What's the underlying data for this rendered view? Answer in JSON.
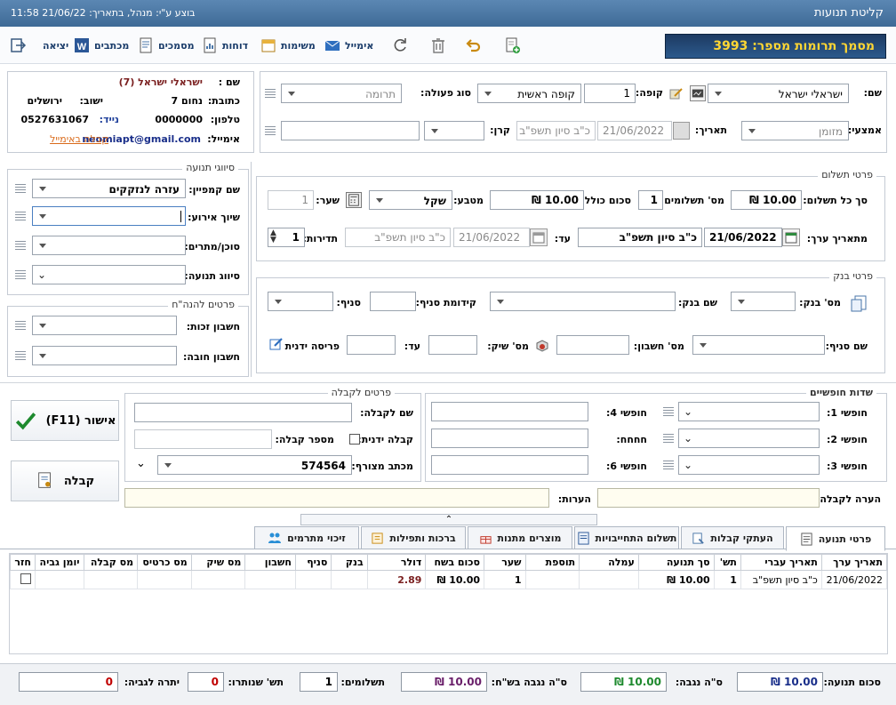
{
  "window": {
    "title": "קליטת תנועות",
    "status": "בוצע ע\"י: מנהל, בתאריך: 21/06/22 11:58"
  },
  "banner": "מסמך תרומות מספר: 3993",
  "toolbar": {
    "exit": "יציאה",
    "letters": "מכתבים",
    "documents": "מסמכים",
    "reports": "דוחות",
    "tasks": "משימות",
    "email": "אימייל"
  },
  "donor": {
    "name_label": "שם :",
    "name": "ישראלי ישראל (7)",
    "address_label": "כתובת:",
    "address": "נחום 7",
    "city_label": "ישוב:",
    "city": "ירושלים",
    "phone_label": "טלפון:",
    "phone": "0000000",
    "mobile_label": "נייד:",
    "mobile": "0527631067",
    "email_label": "אימייל:",
    "email": "neomiapt@gmail.com",
    "email_receipt": "קבלה באימייל"
  },
  "header": {
    "name_label": "שם:",
    "name": "ישראלי ישראל",
    "cashbox_label": "קופה:",
    "cashbox_num": "1",
    "cashbox": "קופה ראשית",
    "action_label": "סוג פעולה:",
    "action": "תרומה",
    "means_label": "אמצעי:",
    "means": "מזומן",
    "date_label": "תאריך:",
    "date": "21/06/2022",
    "hebdate": "כ\"ב סיון תשפ\"ב",
    "fund_label": "קרן:"
  },
  "payment": {
    "section": "פרטי תשלום",
    "each_label": "סך כל תשלום:",
    "each": "10.00 ₪",
    "count_label": "מס' תשלומים",
    "count": "1",
    "total_label": "סכום כולל:",
    "total": "10.00 ₪",
    "currency_label": "מטבע:",
    "currency": "שקל",
    "rate_label": "שער:",
    "rate": "1",
    "from_label": "מתאריך ערך:",
    "from_date": "21/06/2022",
    "from_heb": "כ\"ב סיון תשפ\"ב",
    "to_label": "עד:",
    "to_date": "21/06/2022",
    "to_heb": "כ\"ב סיון תשפ\"ב",
    "freq_label": "תדירות:",
    "freq": "1"
  },
  "bank": {
    "section": "פרטי בנק",
    "bank_num_label": "מס' בנק:",
    "bank_name_label": "שם בנק:",
    "prefix_label": "קידומת סניף:",
    "branch_label": "סניף:",
    "branch_name_label": "שם סניף:",
    "account_label": "מס' חשבון:",
    "check_label": "מס' שיק:",
    "until_label": "עד:",
    "manual_label": "פריסה ידנית"
  },
  "classes": {
    "section": "סיווגי תנועה",
    "campaign_label": "שם קמפיין:",
    "campaign": "עזרה לנזקקים",
    "event_label": "שיוך אירוע:",
    "agent_label": "סוכן/מתרים:",
    "class_label": "סיווג תנועה:"
  },
  "accounting": {
    "section": "פרטים להנה\"ח",
    "credit_label": "חשבון זכות:",
    "debit_label": "חשבון חובה:"
  },
  "free": {
    "section": "שדות חופשיים",
    "f1": "חופשי 1:",
    "f2": "חופשי 2:",
    "f3": "חופשי 3:",
    "f4": "חופשי 4:",
    "f5": "חחחח:",
    "f6": "חופשי 6:"
  },
  "receipt": {
    "section": "פרטים לקבלה",
    "name_label": "שם לקבלה:",
    "manual_label": "קבלה ידנית:",
    "number_label": "מספר קבלה:",
    "letter_label": "מכתב מצורף:",
    "letter": "574564",
    "notes_label": "הערות:",
    "receipt_note_label": "הערה לקבלה:"
  },
  "buttons": {
    "confirm": "אישור (F11)",
    "receipt": "קבלה"
  },
  "tabs": [
    "פרטי תנועה",
    "העתקי קבלות",
    "תשלום התחייבויות",
    "מוצרים מתנות",
    "ברכות ותפילות",
    "זיכוי מתרמים"
  ],
  "grid": {
    "columns": [
      "תאריך ערך",
      "תאריך עברי",
      "תש'",
      "סך תנועה",
      "עמלה",
      "תוספת",
      "שער",
      "סכום בשח",
      "דולר",
      "בנק",
      "סניף",
      "חשבון",
      "מס שיק",
      "מס כרטיס",
      "מס קבלה",
      "יומן גביה",
      "חזר"
    ],
    "rows": [
      [
        "21/06/2022",
        "כ\"ב סיון תשפ\"ב",
        "1",
        "10.00 ₪",
        "",
        "",
        "1",
        "10.00 ₪",
        "2.89",
        "",
        "",
        "",
        "",
        "",
        "",
        "",
        ""
      ]
    ]
  },
  "footer": {
    "total_label": "סכום תנועה:",
    "total": "10.00 ₪",
    "collected_label": "ס\"ה נגבה:",
    "collected": "10.00 ₪",
    "collected_nis_label": "ס\"ה נגבה בש\"ח:",
    "collected_nis": "10.00 ₪",
    "payments_label": "תשלומים:",
    "payments": "1",
    "paid_label": "תש' שנותרו:",
    "paid": "0",
    "balance_label": "יתרה לגביה:",
    "balance": "0"
  },
  "colors": {
    "title": "#3e6a96",
    "banner_text": "#ffd633",
    "green": "#1e8a2e",
    "purple": "#6a1f6a",
    "red": "#c00000"
  }
}
